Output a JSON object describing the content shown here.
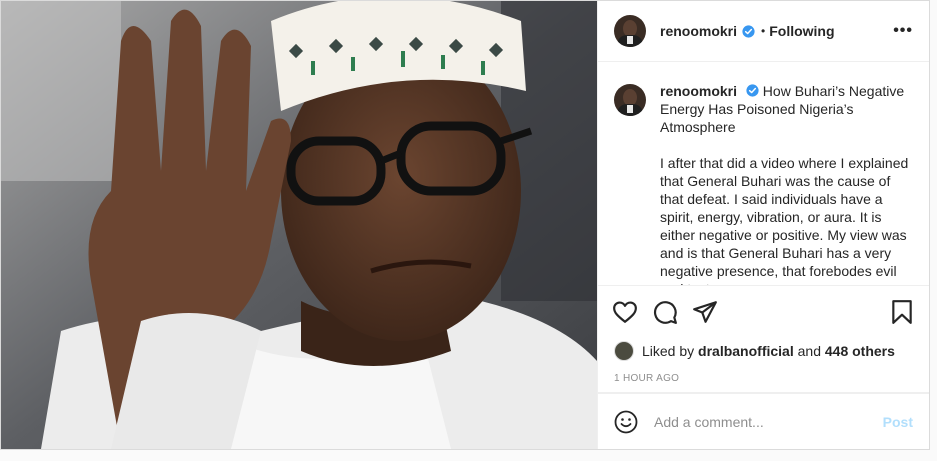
{
  "header": {
    "username": "renoomokri",
    "separator": "•",
    "follow_status": "Following",
    "more": "•••"
  },
  "caption": {
    "username": "renoomokri",
    "title": "How Buhari’s Negative Energy Has Poisoned Nigeria’s Atmosphere",
    "body": "I after that did a video where I explained that General Buhari was the cause of that defeat. I said individuals have a spirit, energy, vibration, or aura. It is either negative or positive. My view was and is that General Buhari has a very negative presence, that forebodes evil and test"
  },
  "likes": {
    "prefix": "Liked by",
    "user": "dralbanofficial",
    "conj": "and",
    "others": "448 others"
  },
  "timestamp": "1 HOUR AGO",
  "comment": {
    "placeholder": "Add a comment...",
    "post_label": "Post"
  },
  "colors": {
    "verified": "#3897f0",
    "post_disabled": "#b2dffc",
    "muted": "#8e8e8e"
  },
  "icons": [
    "verified-badge-icon",
    "more-options-icon",
    "heart-icon",
    "comment-icon",
    "share-icon",
    "bookmark-icon",
    "emoji-icon"
  ]
}
